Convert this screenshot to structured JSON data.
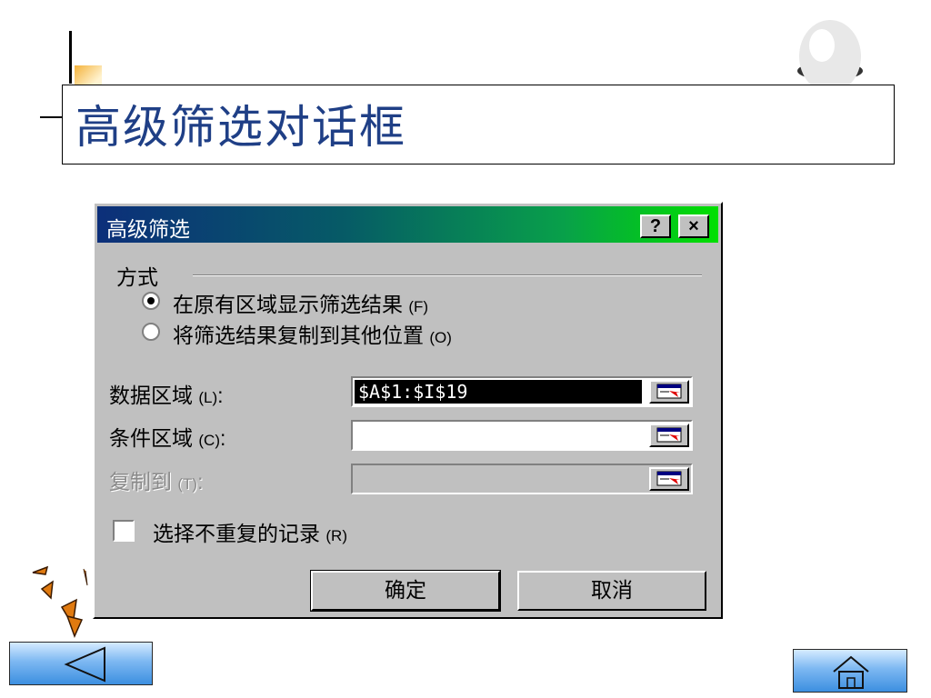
{
  "slide": {
    "title": "高级筛选对话框"
  },
  "dialog": {
    "title": "高级筛选",
    "help_button": "?",
    "close_button": "×",
    "group_label": "方式",
    "radio_options": [
      {
        "label": "在原有区域显示筛选结果",
        "mnemonic": "(F)",
        "selected": true
      },
      {
        "label": "将筛选结果复制到其他位置",
        "mnemonic": "(O)",
        "selected": false
      }
    ],
    "fields": {
      "list_range": {
        "label": "数据区域",
        "mnemonic": "(L)",
        "colon": ":",
        "value": "$A$1:$I$19"
      },
      "criteria_range": {
        "label": "条件区域",
        "mnemonic": "(C)",
        "colon": ":",
        "value": ""
      },
      "copy_to": {
        "label": "复制到",
        "mnemonic": "(T)",
        "colon": ":",
        "value": "",
        "disabled": true
      }
    },
    "unique_checkbox": {
      "label": "选择不重复的记录",
      "mnemonic": "(R)",
      "checked": false
    },
    "ok_button": "确定",
    "cancel_button": "取消"
  },
  "icons": {
    "ref_button": "collapse-dialog-icon",
    "nav_back": "back-arrow-icon",
    "nav_home": "home-icon"
  },
  "colors": {
    "title_text": "#1f3f86",
    "titlebar_start": "#0c2f7a",
    "titlebar_end": "#00e000",
    "dialog_face": "#c0c0c0"
  }
}
